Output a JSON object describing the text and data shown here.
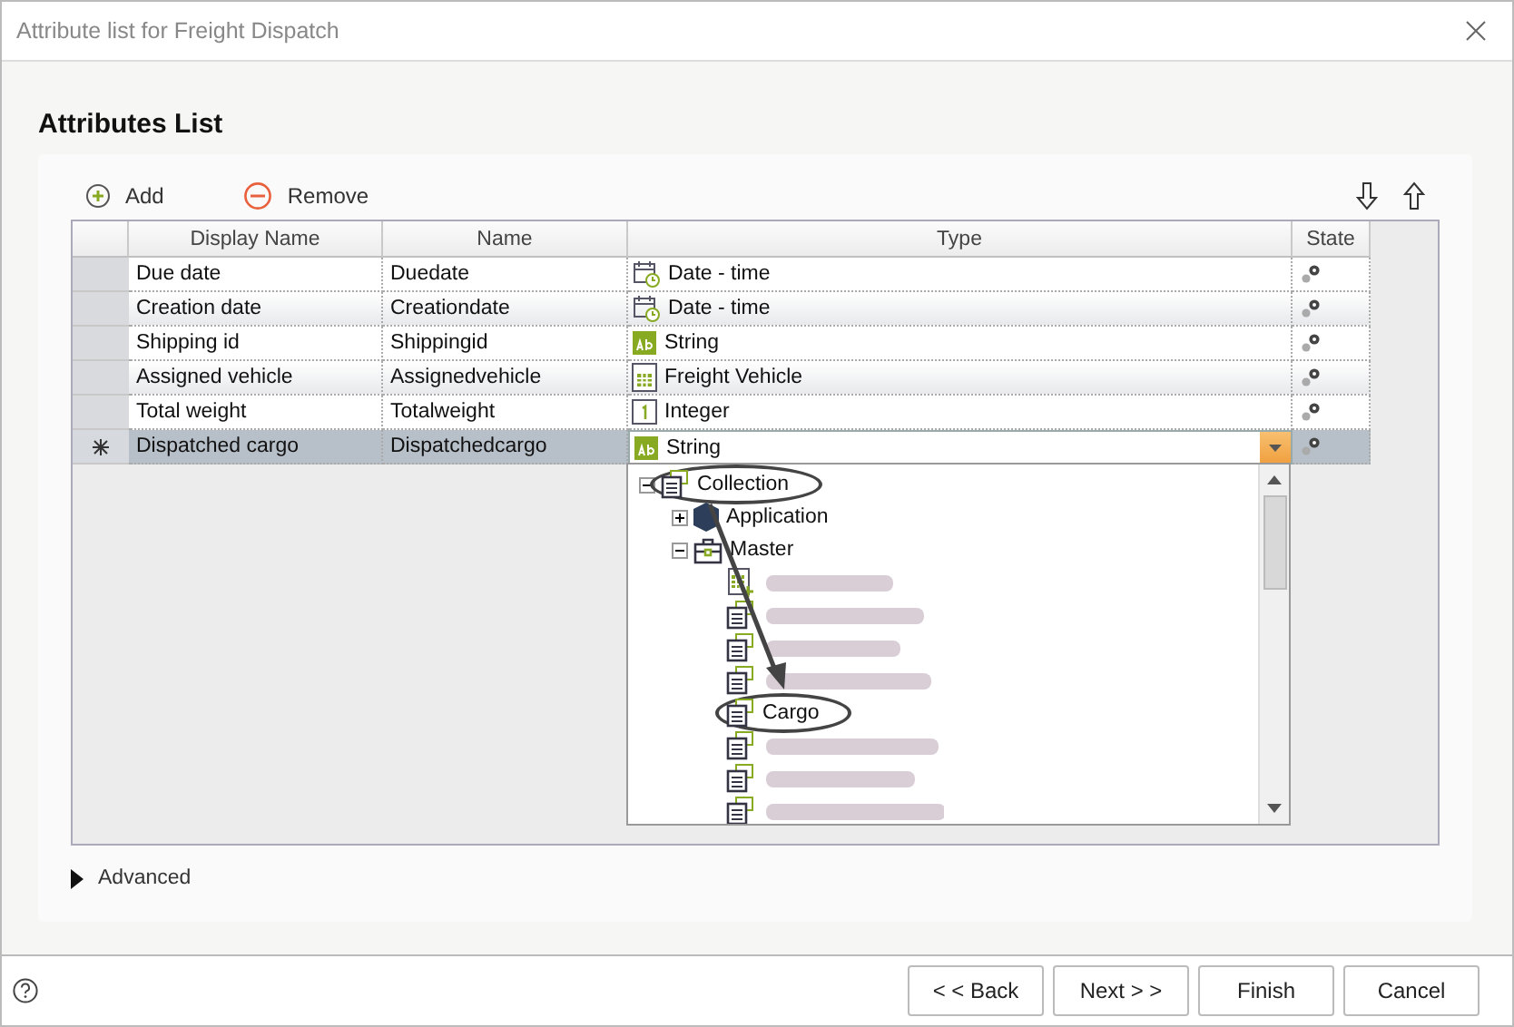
{
  "window": {
    "title": "Attribute list for Freight Dispatch"
  },
  "heading": "Attributes List",
  "toolbar": {
    "add": "Add",
    "remove": "Remove"
  },
  "columns": [
    "Display Name",
    "Name",
    "Type",
    "State"
  ],
  "rows": [
    {
      "display_name": "Due date",
      "name": "Duedate",
      "type": "Date - time",
      "kind": "datetime",
      "selected": false,
      "new": false
    },
    {
      "display_name": "Creation date",
      "name": "Creationdate",
      "type": "Date - time",
      "kind": "datetime",
      "selected": false,
      "new": false
    },
    {
      "display_name": "Shipping id",
      "name": "Shippingid",
      "type": "String",
      "kind": "string",
      "selected": false,
      "new": false
    },
    {
      "display_name": "Assigned vehicle",
      "name": "Assignedvehicle",
      "type": "Freight Vehicle",
      "kind": "entity",
      "selected": false,
      "new": false
    },
    {
      "display_name": "Total weight",
      "name": "Totalweight",
      "type": "Integer",
      "kind": "integer",
      "selected": false,
      "new": false
    },
    {
      "display_name": "Dispatched cargo",
      "name": "Dispatchedcargo",
      "type": "String",
      "kind": "string",
      "selected": true,
      "new": true
    }
  ],
  "dropdown": {
    "tree": [
      {
        "kind": "collection",
        "label": "Collection",
        "expanded": true,
        "circled": true,
        "children": [
          {
            "kind": "module",
            "label": "Application",
            "expanded": false,
            "circled": false
          },
          {
            "kind": "folder",
            "label": "Master",
            "expanded": true,
            "circled": false,
            "children": [
              {
                "kind": "blurrednew"
              },
              {
                "kind": "blurred"
              },
              {
                "kind": "blurred"
              },
              {
                "kind": "blurred"
              },
              {
                "kind": "entity",
                "label": "Cargo",
                "circled": true
              },
              {
                "kind": "blurred"
              },
              {
                "kind": "blurred"
              },
              {
                "kind": "blurred"
              }
            ]
          }
        ]
      }
    ]
  },
  "advanced": {
    "label": "Advanced",
    "expanded": false
  },
  "buttons": [
    "< < Back",
    "Next > >",
    "Finish",
    "Cancel"
  ]
}
